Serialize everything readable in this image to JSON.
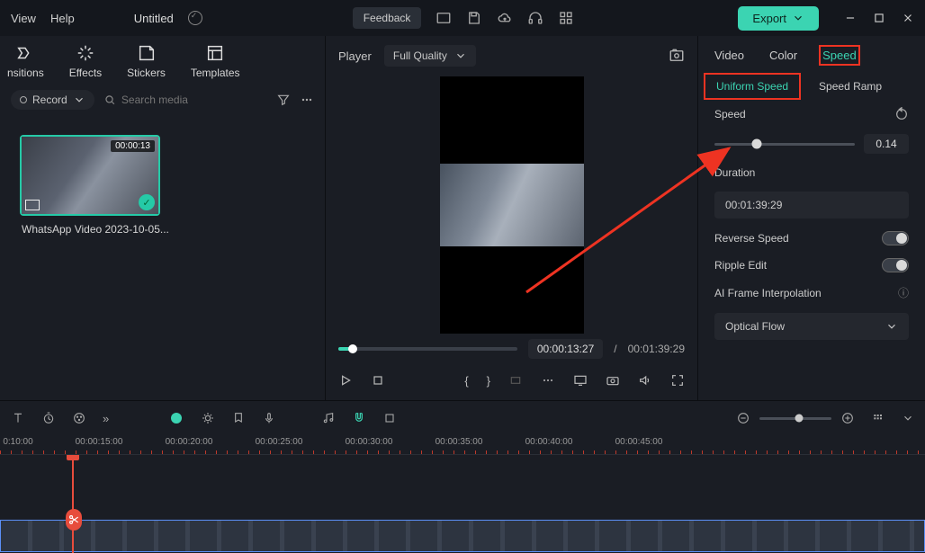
{
  "titlebar": {
    "menus": {
      "view": "View",
      "help": "Help"
    },
    "doc_title": "Untitled",
    "feedback": "Feedback",
    "export": "Export"
  },
  "media_tabs": {
    "t1": "nsitions",
    "t2": "Effects",
    "t3": "Stickers",
    "t4": "Templates"
  },
  "media_search": {
    "record": "Record",
    "placeholder": "Search media"
  },
  "clip": {
    "duration": "00:00:13",
    "name": "WhatsApp Video 2023-10-05..."
  },
  "preview": {
    "player_label": "Player",
    "quality": "Full Quality",
    "time_current": "00:00:13:27",
    "time_sep": "/",
    "time_total": "00:01:39:29"
  },
  "inspector": {
    "tabs": {
      "video": "Video",
      "color": "Color",
      "speed": "Speed"
    },
    "subtabs": {
      "uniform": "Uniform Speed",
      "ramp": "Speed Ramp"
    },
    "speed_label": "Speed",
    "speed_value": "0.14",
    "duration_label": "Duration",
    "duration_value": "00:01:39:29",
    "reverse_label": "Reverse Speed",
    "ripple_label": "Ripple Edit",
    "ai_label": "AI Frame Interpolation",
    "ai_value": "Optical Flow"
  },
  "timeline": {
    "ticks": [
      "0:10:00",
      "00:00:15:00",
      "00:00:20:00",
      "00:00:25:00",
      "00:00:30:00",
      "00:00:35:00",
      "00:00:40:00",
      "00:00:45:00"
    ]
  },
  "chart_data": {
    "type": "table",
    "note": "No chart present; UI screenshot of a video editor speed panel."
  }
}
